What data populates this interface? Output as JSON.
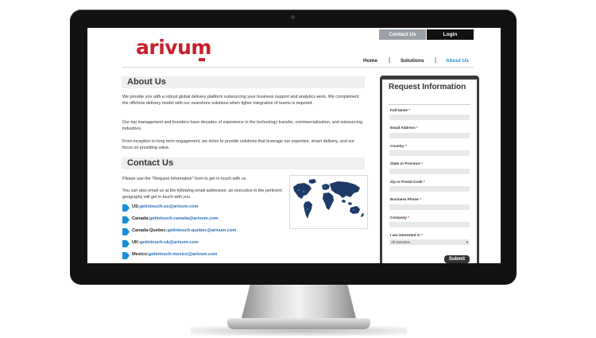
{
  "header": {
    "logo_text": "arivum",
    "top_buttons": {
      "contact": "Contact Us",
      "login": "Login"
    },
    "nav": [
      {
        "label": "Home"
      },
      {
        "label": "Solutions"
      },
      {
        "label": "About Us",
        "active": true
      }
    ],
    "nav_separator": "|"
  },
  "about": {
    "heading": "About Us",
    "paragraphs": [
      "We provide you with a robust global delivery platform outsourcing your business support and analytics work. We complement the offshore delivery model with our nearshore solutions when tigher integration of teams is required.",
      "Our top management and founders have decades of experience in the technology transfer, commercialization, and outsourcing industries.",
      "From inception to long term engagement, we strive to provide solutions that leverage our expertise, smart delivery, and our focus on providing value."
    ]
  },
  "contact": {
    "heading": "Contact Us",
    "intro": "Please use the \"Request Information\" form to get in touch with us.",
    "email_intro": "You can also email us at the following email addresses: an executive in the pertinent geography will get in touch with you.",
    "emails": [
      {
        "region": "US:",
        "address": "getintouch-us@arivum.com"
      },
      {
        "region": "Canada:",
        "address": "getintouch-canada@arivum.com"
      },
      {
        "region": "Canada-Quebec:",
        "address": "getintouch-quebec@arivum.com"
      },
      {
        "region": "UK:",
        "address": "getintouch-uk@arivum.com"
      },
      {
        "region": "Mexico:",
        "address": "getintouch-mexico@arivum.com"
      }
    ]
  },
  "form": {
    "title": "Request Information",
    "required_marker": "*",
    "fields": [
      {
        "label": "Full Name"
      },
      {
        "label": "Email Address"
      },
      {
        "label": "Country"
      },
      {
        "label": "State or Province"
      },
      {
        "label": "Zip or Postal Code"
      },
      {
        "label": "Business Phone"
      },
      {
        "label": "Company"
      }
    ],
    "interest": {
      "label": "I am interested in",
      "selected": "All Services",
      "caret": "▾"
    },
    "submit_label": "Submit"
  },
  "colors": {
    "brand_red": "#c8202d",
    "link_blue": "#2a6fb8",
    "nav_active": "#2a8fd0",
    "arrow_blue": "#1a8fd6",
    "map_navy": "#1e3a66"
  },
  "icons": {
    "map": "world-map-icon",
    "bullet": "arrow-bullet-icon"
  }
}
